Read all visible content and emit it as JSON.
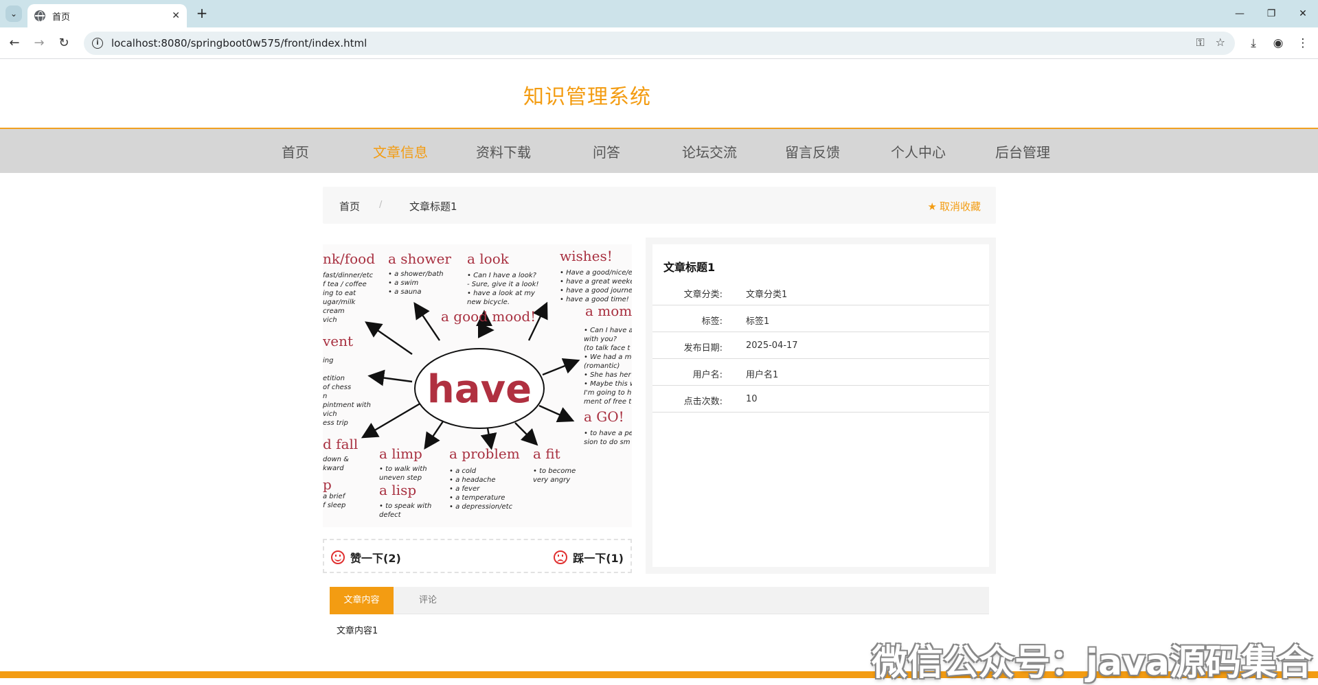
{
  "browser": {
    "tab_title": "首页",
    "url": "localhost:8080/springboot0w575/front/index.html"
  },
  "site": {
    "title": "知识管理系统",
    "nav": [
      "首页",
      "文章信息",
      "资料下载",
      "问答",
      "论坛交流",
      "留言反馈",
      "个人中心",
      "后台管理"
    ],
    "active_nav": "文章信息"
  },
  "breadcrumb": {
    "home": "首页",
    "separator": "/",
    "current": "文章标题1",
    "favorite_label": "取消收藏"
  },
  "cover": {
    "center_word": "have",
    "words": [
      "nk/food",
      "a shower",
      "a look",
      "wishes!",
      "a good mood!",
      "a mome",
      "vent",
      "a GO!",
      "d fall",
      "a limp",
      "a problem",
      "a fit",
      "a lisp",
      "p"
    ],
    "notes": {
      "food": [
        "fast/dinner/etc",
        "f tea / coffee",
        "ing to eat",
        "ugar/milk",
        "cream",
        "vich"
      ],
      "shower": [
        "• a shower/bath",
        "• a swim",
        "• a sauna"
      ],
      "look": [
        "• Can I have a look?",
        "- Sure, give it a look!",
        "• have a look at my",
        "new bicycle."
      ],
      "wishes": [
        "• Have a good/nice/et",
        "• have a great weeken",
        "• have a good journey",
        "• have a good time!"
      ],
      "moment": [
        "• Can I have a",
        "with you?",
        "(to talk face t",
        "• We had a mo",
        "(romantic)",
        "• She has her m",
        "• Maybe this w",
        "I'm going to h",
        "ment of free t"
      ],
      "event": [
        "ing",
        "",
        "etition",
        "of chess",
        "n",
        "pintment with",
        "vich",
        "ess trip"
      ],
      "go": [
        "• to have a per",
        "sion to do sm"
      ],
      "fall": [
        "down &",
        "kward"
      ],
      "limp": [
        "• to walk with",
        "uneven step"
      ],
      "problem": [
        "• a cold",
        "• a headache",
        "• a fever",
        "• a temperature",
        "• a depression/etc"
      ],
      "fit": [
        "• to become",
        "very angry"
      ],
      "lisp": [
        "• to speak with",
        "defect"
      ],
      "p": [
        "a brief",
        "f sleep"
      ]
    }
  },
  "votes": {
    "like_label": "赞一下(2)",
    "dislike_label": "踩一下(1)"
  },
  "detail": {
    "title": "文章标题1",
    "rows": [
      {
        "label": "文章分类:",
        "value": "文章分类1"
      },
      {
        "label": "标签:",
        "value": "标签1"
      },
      {
        "label": "发布日期:",
        "value": "2025-04-17"
      },
      {
        "label": "用户名:",
        "value": "用户名1"
      },
      {
        "label": "点击次数:",
        "value": "10"
      }
    ]
  },
  "tabs": {
    "content_tab": "文章内容",
    "comment_tab": "评论",
    "content_text": "文章内容1"
  },
  "watermark": "微信公众号：java源码集合",
  "colors": {
    "accent": "#f39c12",
    "nav_bg": "#d6d6d6",
    "vote_icon": "#e03030"
  }
}
